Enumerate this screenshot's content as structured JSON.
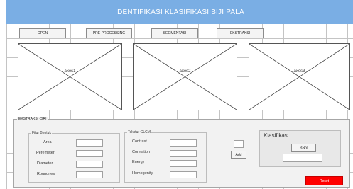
{
  "window": {
    "title": "IDENTIFIKASI KLASIFIKASI BIJI PALA",
    "title_bg": "#7aaee4"
  },
  "toolbar": {
    "open_label": "OPEN",
    "preprocessing_label": "PRE-PROCESSING",
    "segmentasi_label": "SEGMENTASI",
    "ekstraksi_label": "EKSTRAKSI"
  },
  "axes": [
    {
      "label": "axes1"
    },
    {
      "label": "axes2"
    },
    {
      "label": "axes3"
    }
  ],
  "ekstraksi_panel": {
    "title": "EKSTRAKSI CIRI",
    "fitur_bentuk": {
      "title": "Fitur Bentuk",
      "fields": [
        {
          "label": "Area",
          "value": ""
        },
        {
          "label": "Peremeter",
          "value": ""
        },
        {
          "label": "Diameter",
          "value": ""
        },
        {
          "label": "Roundnes",
          "value": ""
        }
      ]
    },
    "tekstur_glcm": {
      "title": "Tekstur GLCM",
      "fields": [
        {
          "label": "Contrast",
          "value": ""
        },
        {
          "label": "Corelation",
          "value": ""
        },
        {
          "label": "Energy",
          "value": ""
        },
        {
          "label": "Homogenity",
          "value": ""
        }
      ]
    },
    "add": {
      "field_value": "",
      "button_label": "Add"
    },
    "klasifikasi": {
      "title": "Klasifikasi",
      "knn_label": "KNN",
      "result_value": ""
    }
  },
  "reset": {
    "label": "Reset",
    "color": "#ff0000"
  }
}
